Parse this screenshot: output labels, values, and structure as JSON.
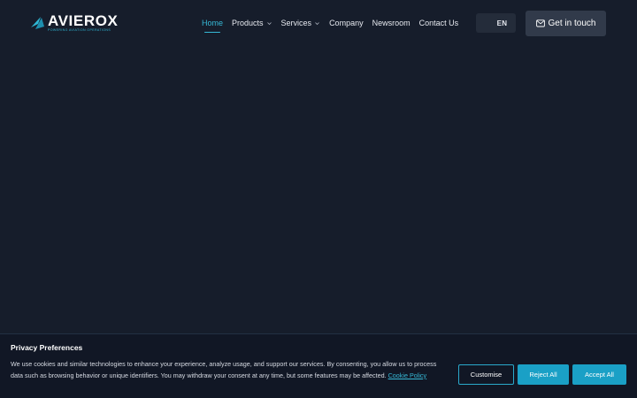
{
  "brand": {
    "name": "AVIEROX",
    "tagline": "POWERING AVIATION OPERATIONS",
    "accent": "#2fb6d3"
  },
  "nav": {
    "items": [
      {
        "label": "Home",
        "active": true,
        "dropdown": false
      },
      {
        "label": "Products",
        "active": false,
        "dropdown": true
      },
      {
        "label": "Services",
        "active": false,
        "dropdown": true
      },
      {
        "label": "Company",
        "active": false,
        "dropdown": false
      },
      {
        "label": "Newsroom",
        "active": false,
        "dropdown": false
      },
      {
        "label": "Contact Us",
        "active": false,
        "dropdown": false
      }
    ],
    "dropdown_icon": "chevron-down-icon"
  },
  "language": {
    "label": "EN"
  },
  "cta": {
    "label": "Get in touch",
    "icon": "mail-icon"
  },
  "cookie": {
    "title": "Privacy Preferences",
    "body": "We use cookies and similar technologies to enhance your experience, analyze usage, and support our services. By consenting, you allow us to process data such as browsing behavior or unique identifiers. You may withdraw your consent at any time, but some features may be affected.",
    "policy_link": "Cookie Policy",
    "buttons": {
      "customise": "Customise",
      "reject": "Reject All",
      "accept": "Accept All"
    }
  },
  "colors": {
    "background": "#161d2b",
    "banner": "#111725",
    "primary_button": "#1aa0c6"
  }
}
